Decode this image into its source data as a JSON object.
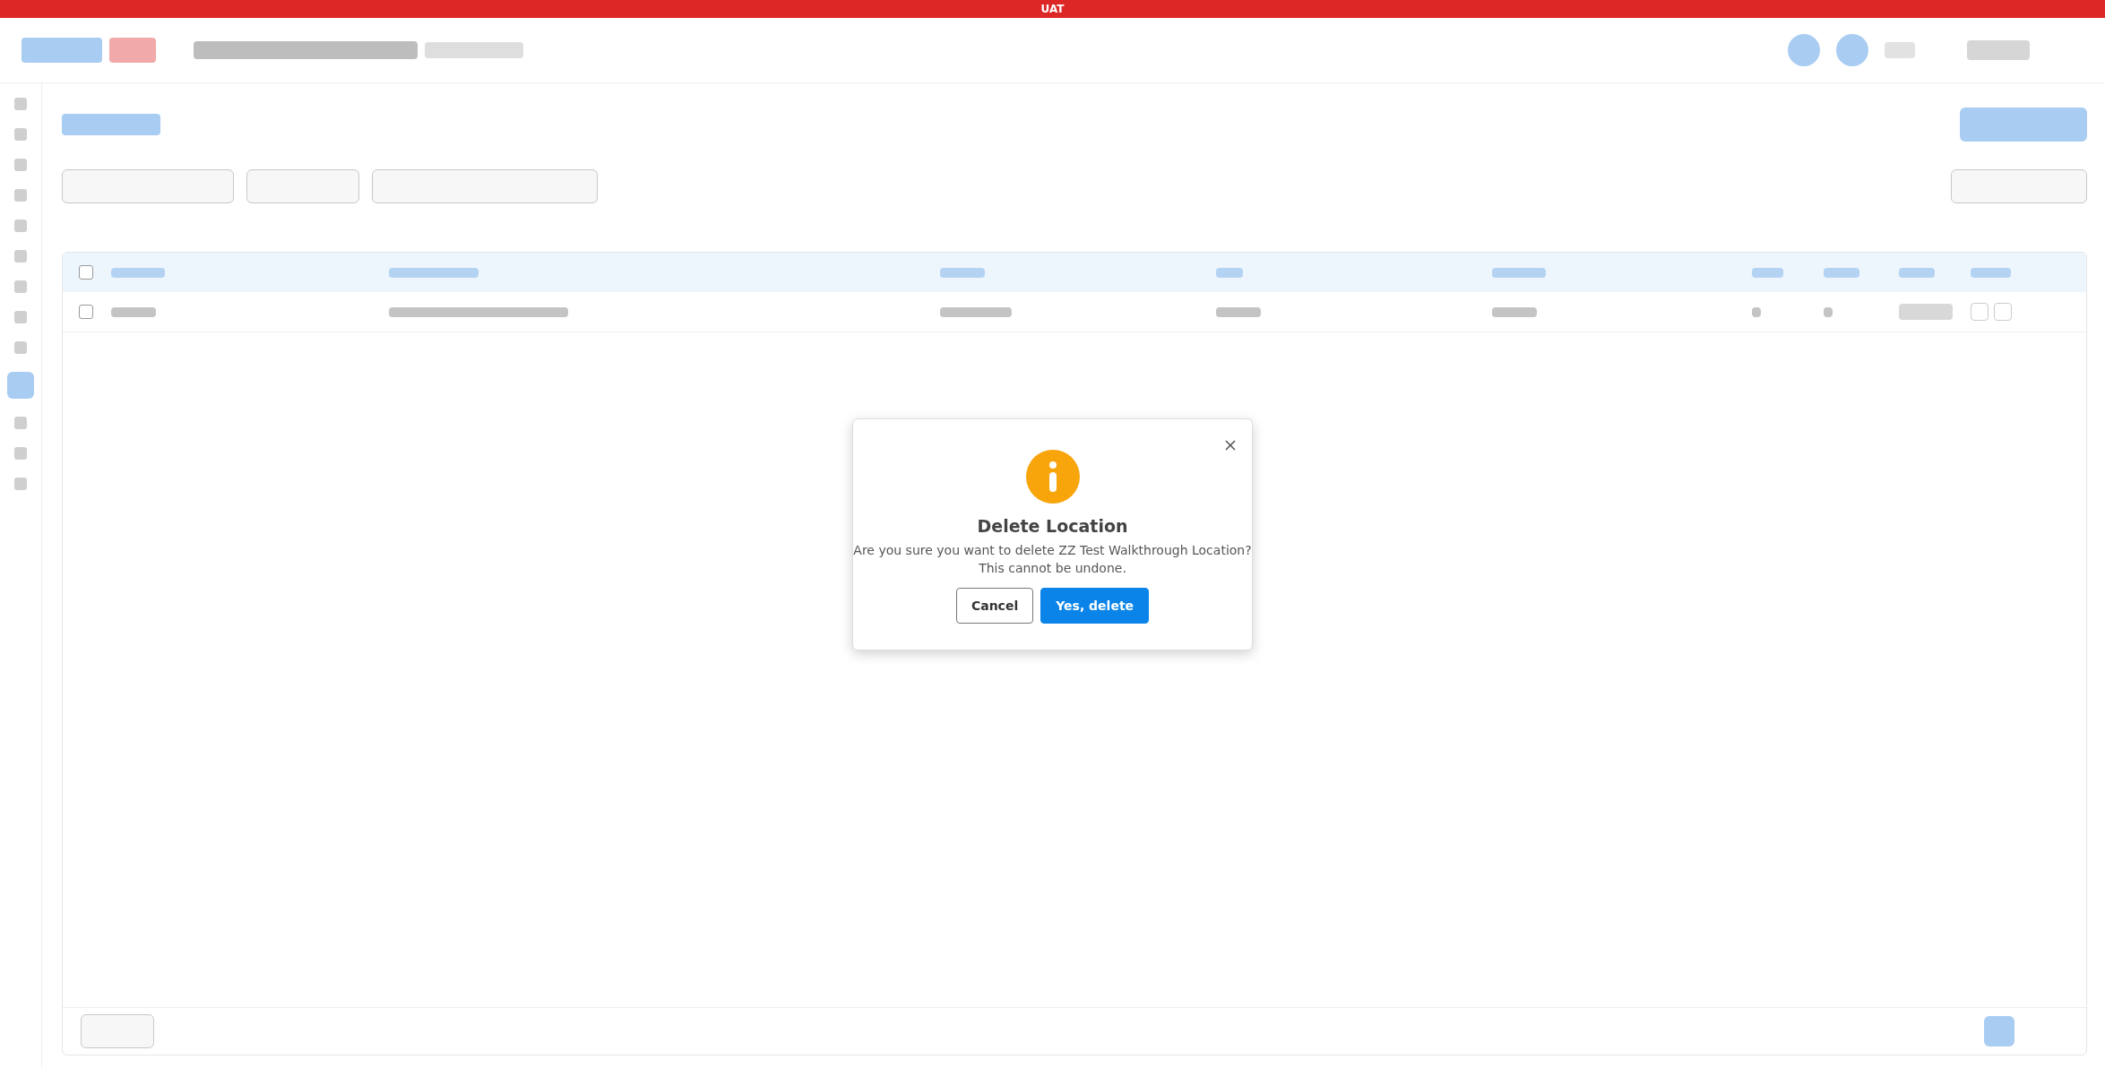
{
  "banner": {
    "text": "UAT"
  },
  "table": {
    "header_checked": false,
    "rows": [
      {
        "checked": false
      }
    ]
  },
  "dialog": {
    "title": "Delete Location",
    "message": [
      "Are you sure you want to delete ZZ Test Walkthrough Location?",
      "This cannot be undone."
    ],
    "buttons": [
      {
        "kind": "secondary",
        "label": "Cancel"
      },
      {
        "kind": "primary",
        "label": "Yes, delete"
      }
    ]
  }
}
